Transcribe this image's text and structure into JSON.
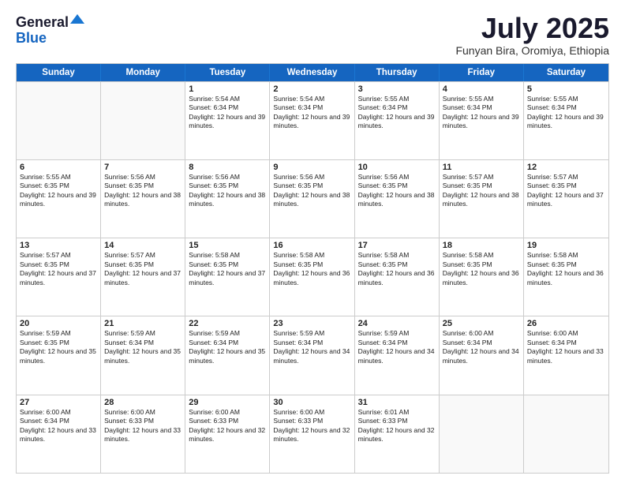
{
  "header": {
    "logo_line1": "General",
    "logo_line2": "Blue",
    "month_title": "July 2025",
    "subtitle": "Funyan Bira, Oromiya, Ethiopia"
  },
  "days_of_week": [
    "Sunday",
    "Monday",
    "Tuesday",
    "Wednesday",
    "Thursday",
    "Friday",
    "Saturday"
  ],
  "weeks": [
    [
      {
        "day": "",
        "sunrise": "",
        "sunset": "",
        "daylight": "",
        "empty": true
      },
      {
        "day": "",
        "sunrise": "",
        "sunset": "",
        "daylight": "",
        "empty": true
      },
      {
        "day": "1",
        "sunrise": "Sunrise: 5:54 AM",
        "sunset": "Sunset: 6:34 PM",
        "daylight": "Daylight: 12 hours and 39 minutes.",
        "empty": false
      },
      {
        "day": "2",
        "sunrise": "Sunrise: 5:54 AM",
        "sunset": "Sunset: 6:34 PM",
        "daylight": "Daylight: 12 hours and 39 minutes.",
        "empty": false
      },
      {
        "day": "3",
        "sunrise": "Sunrise: 5:55 AM",
        "sunset": "Sunset: 6:34 PM",
        "daylight": "Daylight: 12 hours and 39 minutes.",
        "empty": false
      },
      {
        "day": "4",
        "sunrise": "Sunrise: 5:55 AM",
        "sunset": "Sunset: 6:34 PM",
        "daylight": "Daylight: 12 hours and 39 minutes.",
        "empty": false
      },
      {
        "day": "5",
        "sunrise": "Sunrise: 5:55 AM",
        "sunset": "Sunset: 6:34 PM",
        "daylight": "Daylight: 12 hours and 39 minutes.",
        "empty": false
      }
    ],
    [
      {
        "day": "6",
        "sunrise": "Sunrise: 5:55 AM",
        "sunset": "Sunset: 6:35 PM",
        "daylight": "Daylight: 12 hours and 39 minutes.",
        "empty": false
      },
      {
        "day": "7",
        "sunrise": "Sunrise: 5:56 AM",
        "sunset": "Sunset: 6:35 PM",
        "daylight": "Daylight: 12 hours and 38 minutes.",
        "empty": false
      },
      {
        "day": "8",
        "sunrise": "Sunrise: 5:56 AM",
        "sunset": "Sunset: 6:35 PM",
        "daylight": "Daylight: 12 hours and 38 minutes.",
        "empty": false
      },
      {
        "day": "9",
        "sunrise": "Sunrise: 5:56 AM",
        "sunset": "Sunset: 6:35 PM",
        "daylight": "Daylight: 12 hours and 38 minutes.",
        "empty": false
      },
      {
        "day": "10",
        "sunrise": "Sunrise: 5:56 AM",
        "sunset": "Sunset: 6:35 PM",
        "daylight": "Daylight: 12 hours and 38 minutes.",
        "empty": false
      },
      {
        "day": "11",
        "sunrise": "Sunrise: 5:57 AM",
        "sunset": "Sunset: 6:35 PM",
        "daylight": "Daylight: 12 hours and 38 minutes.",
        "empty": false
      },
      {
        "day": "12",
        "sunrise": "Sunrise: 5:57 AM",
        "sunset": "Sunset: 6:35 PM",
        "daylight": "Daylight: 12 hours and 37 minutes.",
        "empty": false
      }
    ],
    [
      {
        "day": "13",
        "sunrise": "Sunrise: 5:57 AM",
        "sunset": "Sunset: 6:35 PM",
        "daylight": "Daylight: 12 hours and 37 minutes.",
        "empty": false
      },
      {
        "day": "14",
        "sunrise": "Sunrise: 5:57 AM",
        "sunset": "Sunset: 6:35 PM",
        "daylight": "Daylight: 12 hours and 37 minutes.",
        "empty": false
      },
      {
        "day": "15",
        "sunrise": "Sunrise: 5:58 AM",
        "sunset": "Sunset: 6:35 PM",
        "daylight": "Daylight: 12 hours and 37 minutes.",
        "empty": false
      },
      {
        "day": "16",
        "sunrise": "Sunrise: 5:58 AM",
        "sunset": "Sunset: 6:35 PM",
        "daylight": "Daylight: 12 hours and 36 minutes.",
        "empty": false
      },
      {
        "day": "17",
        "sunrise": "Sunrise: 5:58 AM",
        "sunset": "Sunset: 6:35 PM",
        "daylight": "Daylight: 12 hours and 36 minutes.",
        "empty": false
      },
      {
        "day": "18",
        "sunrise": "Sunrise: 5:58 AM",
        "sunset": "Sunset: 6:35 PM",
        "daylight": "Daylight: 12 hours and 36 minutes.",
        "empty": false
      },
      {
        "day": "19",
        "sunrise": "Sunrise: 5:58 AM",
        "sunset": "Sunset: 6:35 PM",
        "daylight": "Daylight: 12 hours and 36 minutes.",
        "empty": false
      }
    ],
    [
      {
        "day": "20",
        "sunrise": "Sunrise: 5:59 AM",
        "sunset": "Sunset: 6:35 PM",
        "daylight": "Daylight: 12 hours and 35 minutes.",
        "empty": false
      },
      {
        "day": "21",
        "sunrise": "Sunrise: 5:59 AM",
        "sunset": "Sunset: 6:34 PM",
        "daylight": "Daylight: 12 hours and 35 minutes.",
        "empty": false
      },
      {
        "day": "22",
        "sunrise": "Sunrise: 5:59 AM",
        "sunset": "Sunset: 6:34 PM",
        "daylight": "Daylight: 12 hours and 35 minutes.",
        "empty": false
      },
      {
        "day": "23",
        "sunrise": "Sunrise: 5:59 AM",
        "sunset": "Sunset: 6:34 PM",
        "daylight": "Daylight: 12 hours and 34 minutes.",
        "empty": false
      },
      {
        "day": "24",
        "sunrise": "Sunrise: 5:59 AM",
        "sunset": "Sunset: 6:34 PM",
        "daylight": "Daylight: 12 hours and 34 minutes.",
        "empty": false
      },
      {
        "day": "25",
        "sunrise": "Sunrise: 6:00 AM",
        "sunset": "Sunset: 6:34 PM",
        "daylight": "Daylight: 12 hours and 34 minutes.",
        "empty": false
      },
      {
        "day": "26",
        "sunrise": "Sunrise: 6:00 AM",
        "sunset": "Sunset: 6:34 PM",
        "daylight": "Daylight: 12 hours and 33 minutes.",
        "empty": false
      }
    ],
    [
      {
        "day": "27",
        "sunrise": "Sunrise: 6:00 AM",
        "sunset": "Sunset: 6:34 PM",
        "daylight": "Daylight: 12 hours and 33 minutes.",
        "empty": false
      },
      {
        "day": "28",
        "sunrise": "Sunrise: 6:00 AM",
        "sunset": "Sunset: 6:33 PM",
        "daylight": "Daylight: 12 hours and 33 minutes.",
        "empty": false
      },
      {
        "day": "29",
        "sunrise": "Sunrise: 6:00 AM",
        "sunset": "Sunset: 6:33 PM",
        "daylight": "Daylight: 12 hours and 32 minutes.",
        "empty": false
      },
      {
        "day": "30",
        "sunrise": "Sunrise: 6:00 AM",
        "sunset": "Sunset: 6:33 PM",
        "daylight": "Daylight: 12 hours and 32 minutes.",
        "empty": false
      },
      {
        "day": "31",
        "sunrise": "Sunrise: 6:01 AM",
        "sunset": "Sunset: 6:33 PM",
        "daylight": "Daylight: 12 hours and 32 minutes.",
        "empty": false
      },
      {
        "day": "",
        "sunrise": "",
        "sunset": "",
        "daylight": "",
        "empty": true
      },
      {
        "day": "",
        "sunrise": "",
        "sunset": "",
        "daylight": "",
        "empty": true
      }
    ]
  ]
}
